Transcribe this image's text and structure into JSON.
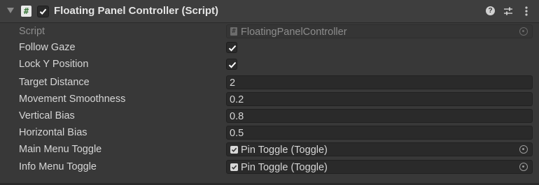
{
  "header": {
    "title": "Floating Panel Controller (Script)",
    "script_icon_glyph": "#",
    "enabled": true,
    "icons": [
      "help-icon",
      "preset-icon",
      "context-menu-icon"
    ]
  },
  "fields": {
    "script": {
      "label": "Script",
      "value": "FloatingPanelController"
    },
    "follow_gaze": {
      "label": "Follow Gaze",
      "checked": true
    },
    "lock_y": {
      "label": "Lock Y Position",
      "checked": true
    },
    "target_distance": {
      "label": "Target Distance",
      "value": "2"
    },
    "movement_smoothness": {
      "label": "Movement Smoothness",
      "value": "0.2"
    },
    "vertical_bias": {
      "label": "Vertical Bias",
      "value": "0.8"
    },
    "horizontal_bias": {
      "label": "Horizontal Bias",
      "value": "0.5"
    },
    "main_menu_toggle": {
      "label": "Main Menu Toggle",
      "value": "Pin Toggle (Toggle)"
    },
    "info_menu_toggle": {
      "label": "Info Menu Toggle",
      "value": "Pin Toggle (Toggle)"
    }
  },
  "colors": {
    "background": "#383838",
    "field_background": "#2a2a2a",
    "label_text": "#d6d6d6",
    "disabled_text": "#8c8c8c"
  }
}
